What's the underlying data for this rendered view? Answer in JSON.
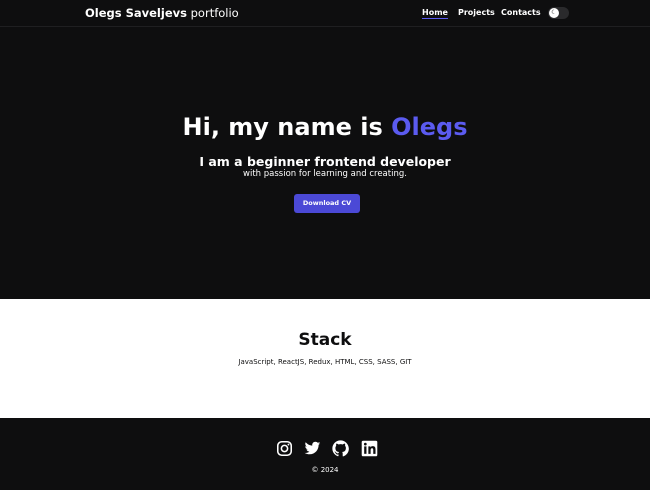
{
  "header": {
    "logo_bold": "Olegs Saveljevs",
    "logo_light": "portfolio",
    "nav": [
      {
        "label": "Home",
        "active": true
      },
      {
        "label": "Projects",
        "active": false
      },
      {
        "label": "Contacts",
        "active": false
      }
    ],
    "theme_toggle": {
      "icon": "moon-icon",
      "state": "dark"
    }
  },
  "hero": {
    "title_prefix": "Hi, my name is ",
    "title_name": "Olegs",
    "subtitle": "I am a beginner frontend developer",
    "description": "with passion for learning and creating.",
    "cta_label": "Download CV"
  },
  "stack": {
    "title": "Stack",
    "technologies": "JavaScript, ReactJS, Redux, HTML, CSS, SASS, GIT"
  },
  "footer": {
    "social": [
      {
        "icon": "instagram-icon"
      },
      {
        "icon": "twitter-icon"
      },
      {
        "icon": "github-icon"
      },
      {
        "icon": "linkedin-icon"
      }
    ],
    "copyright": "© 2024"
  },
  "colors": {
    "accent": "#5b5bf0",
    "button": "#4b49d6",
    "background_dark": "#0e0e0f",
    "background_light": "#ffffff"
  }
}
